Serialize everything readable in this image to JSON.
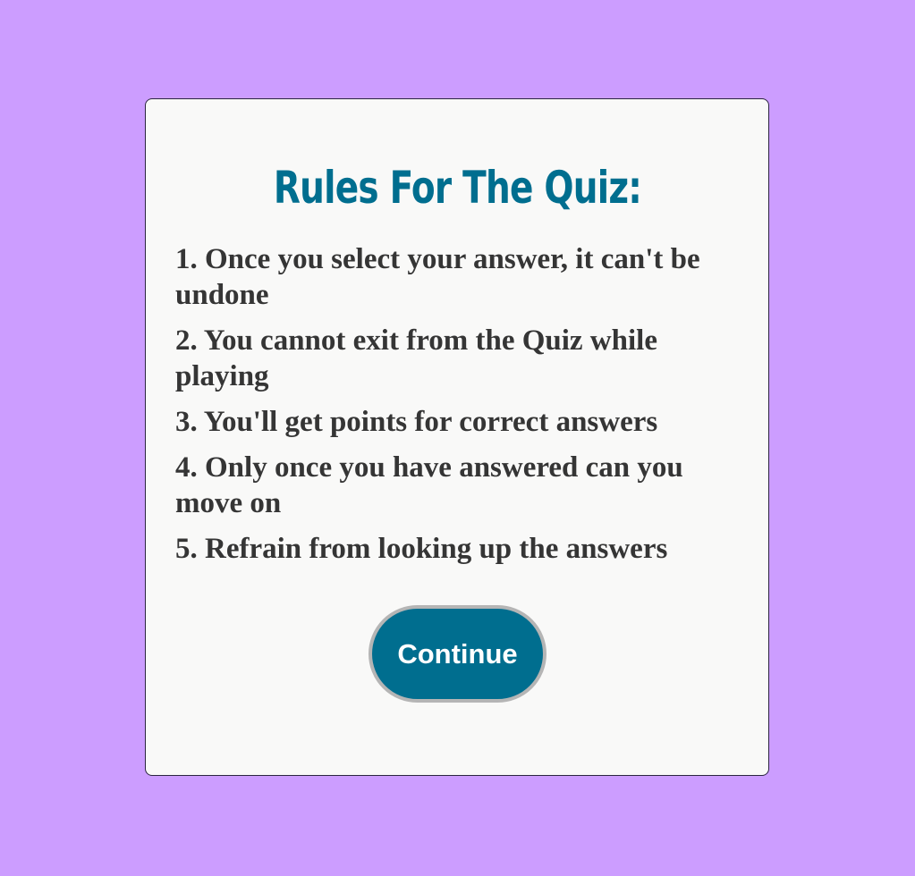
{
  "title": "Rules For The Quiz:",
  "rules": [
    "1. Once you select your answer, it can't be undone",
    "2. You cannot exit from the Quiz while playing",
    "3. You'll get points for correct answers",
    "4. Only once you have answered can you move on",
    "5. Refrain from looking up the answers"
  ],
  "buttons": {
    "continue_label": "Continue"
  },
  "colors": {
    "background": "#cc9dff",
    "card": "#f9f9f8",
    "accent": "#006e8f",
    "text": "#353535",
    "button_border": "#b5b5b5"
  }
}
